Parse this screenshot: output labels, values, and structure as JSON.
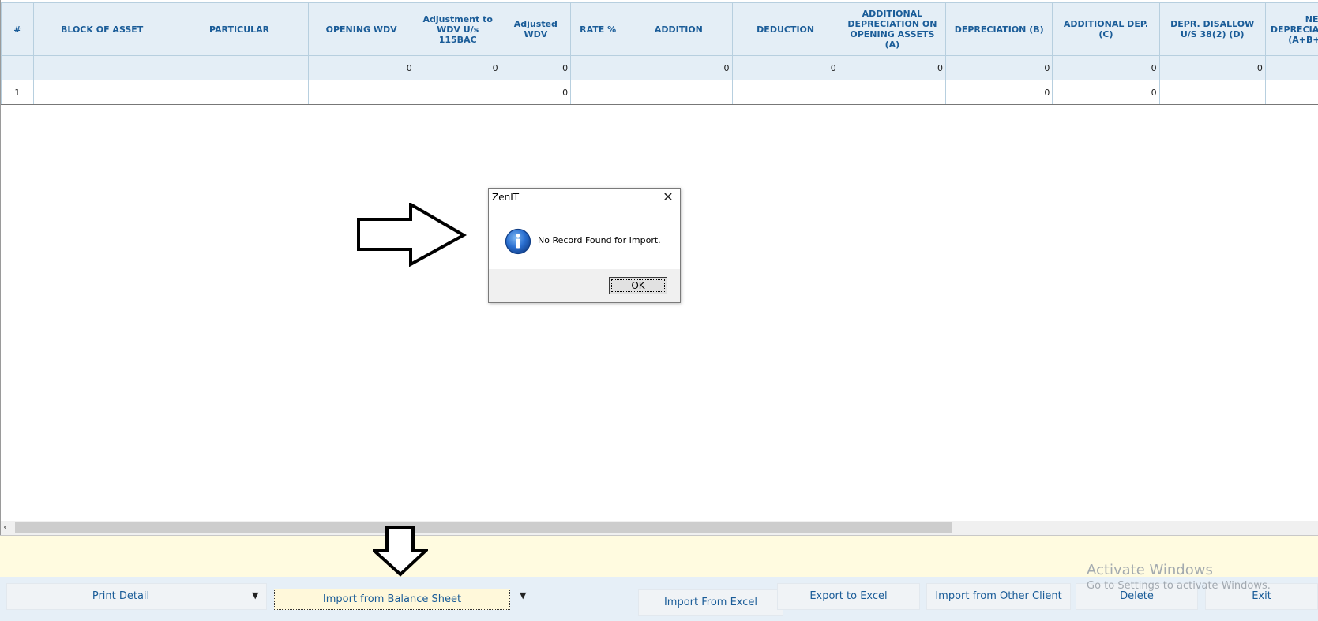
{
  "grid": {
    "columns": [
      {
        "label": "#"
      },
      {
        "label": "BLOCK OF ASSET"
      },
      {
        "label": "PARTICULAR"
      },
      {
        "label": "OPENING WDV"
      },
      {
        "label": "Adjustment to WDV U/s 115BAC"
      },
      {
        "label": "Adjusted WDV"
      },
      {
        "label": "RATE %"
      },
      {
        "label": "ADDITION"
      },
      {
        "label": "DEDUCTION"
      },
      {
        "label": "ADDITIONAL DEPRECIATION ON OPENING ASSETS (A)"
      },
      {
        "label": "DEPRECIATION (B)"
      },
      {
        "label": "ADDITIONAL DEP. (C)"
      },
      {
        "label": "DEPR. DISALLOW U/S 38(2) (D)"
      },
      {
        "label": "NET DEPRECIATION (E)(A+B+C-D)"
      }
    ],
    "totals": [
      "",
      "",
      "",
      "0",
      "0",
      "0",
      "",
      "0",
      "0",
      "0",
      "0",
      "0",
      "0",
      ""
    ],
    "rows": [
      [
        "1",
        "",
        "",
        "",
        "",
        "0",
        "",
        "",
        "",
        "",
        "0",
        "0",
        "",
        ""
      ]
    ]
  },
  "dialog": {
    "title": "ZenIT",
    "close_glyph": "✕",
    "icon": "info-icon",
    "message": "No Record Found for Import.",
    "ok_label": "OK"
  },
  "scrollbar": {
    "left_arrow": "‹"
  },
  "toolbar": {
    "print_detail": "Print Detail",
    "import_balance_sheet": "Import from Balance Sheet",
    "import_excel": "Import From Excel",
    "export_excel": "Export to Excel",
    "import_other_client": "Import from Other Client",
    "delete": "Delete",
    "exit": "Exit",
    "dropdown_glyph": "▼"
  },
  "watermark": {
    "title": "Activate Windows",
    "subtitle": "Go to Settings to activate Windows."
  },
  "colors": {
    "header_bg": "#e4eef6",
    "header_text": "#1a5c98",
    "status_strip": "#fffbe0",
    "toolbar_bg": "#e6eff7"
  }
}
